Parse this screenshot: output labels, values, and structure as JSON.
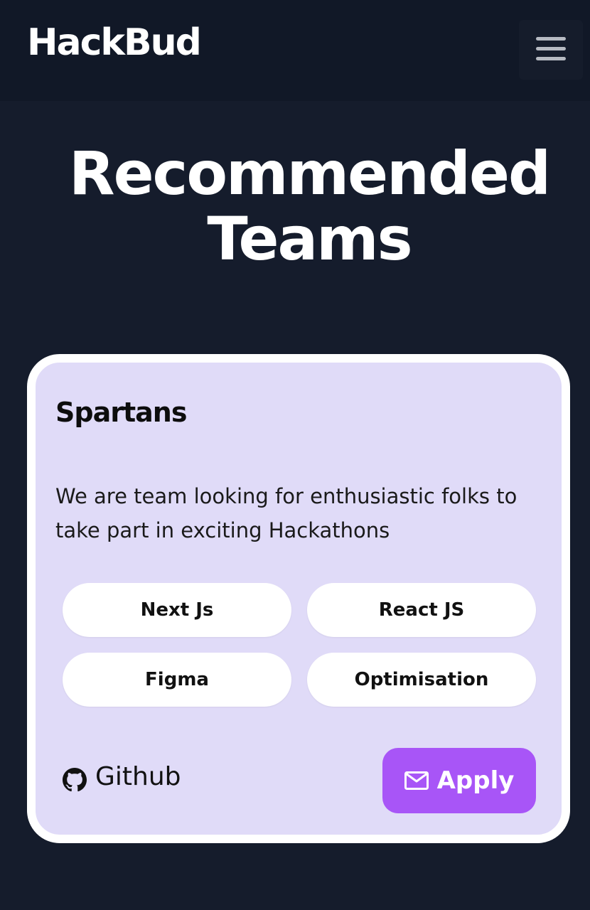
{
  "navbar": {
    "brand": "HackBud",
    "menu_icon": "hamburger-menu-icon"
  },
  "page": {
    "title_line1": "Recommended",
    "title_line2": "Teams"
  },
  "team_card": {
    "name": "Spartans",
    "description": "We are team looking for enthusiastic folks to take part in exciting Hackathons",
    "tags": [
      "Next Js",
      "React JS",
      "Figma",
      "Optimisation"
    ],
    "github_icon": "github-icon",
    "github_label": "Github",
    "apply_icon": "mail-icon",
    "apply_label": "Apply"
  },
  "colors": {
    "background": "#151c2c",
    "navbar": "#111827",
    "card": "#e0dbf8",
    "accent": "#a855f7"
  }
}
